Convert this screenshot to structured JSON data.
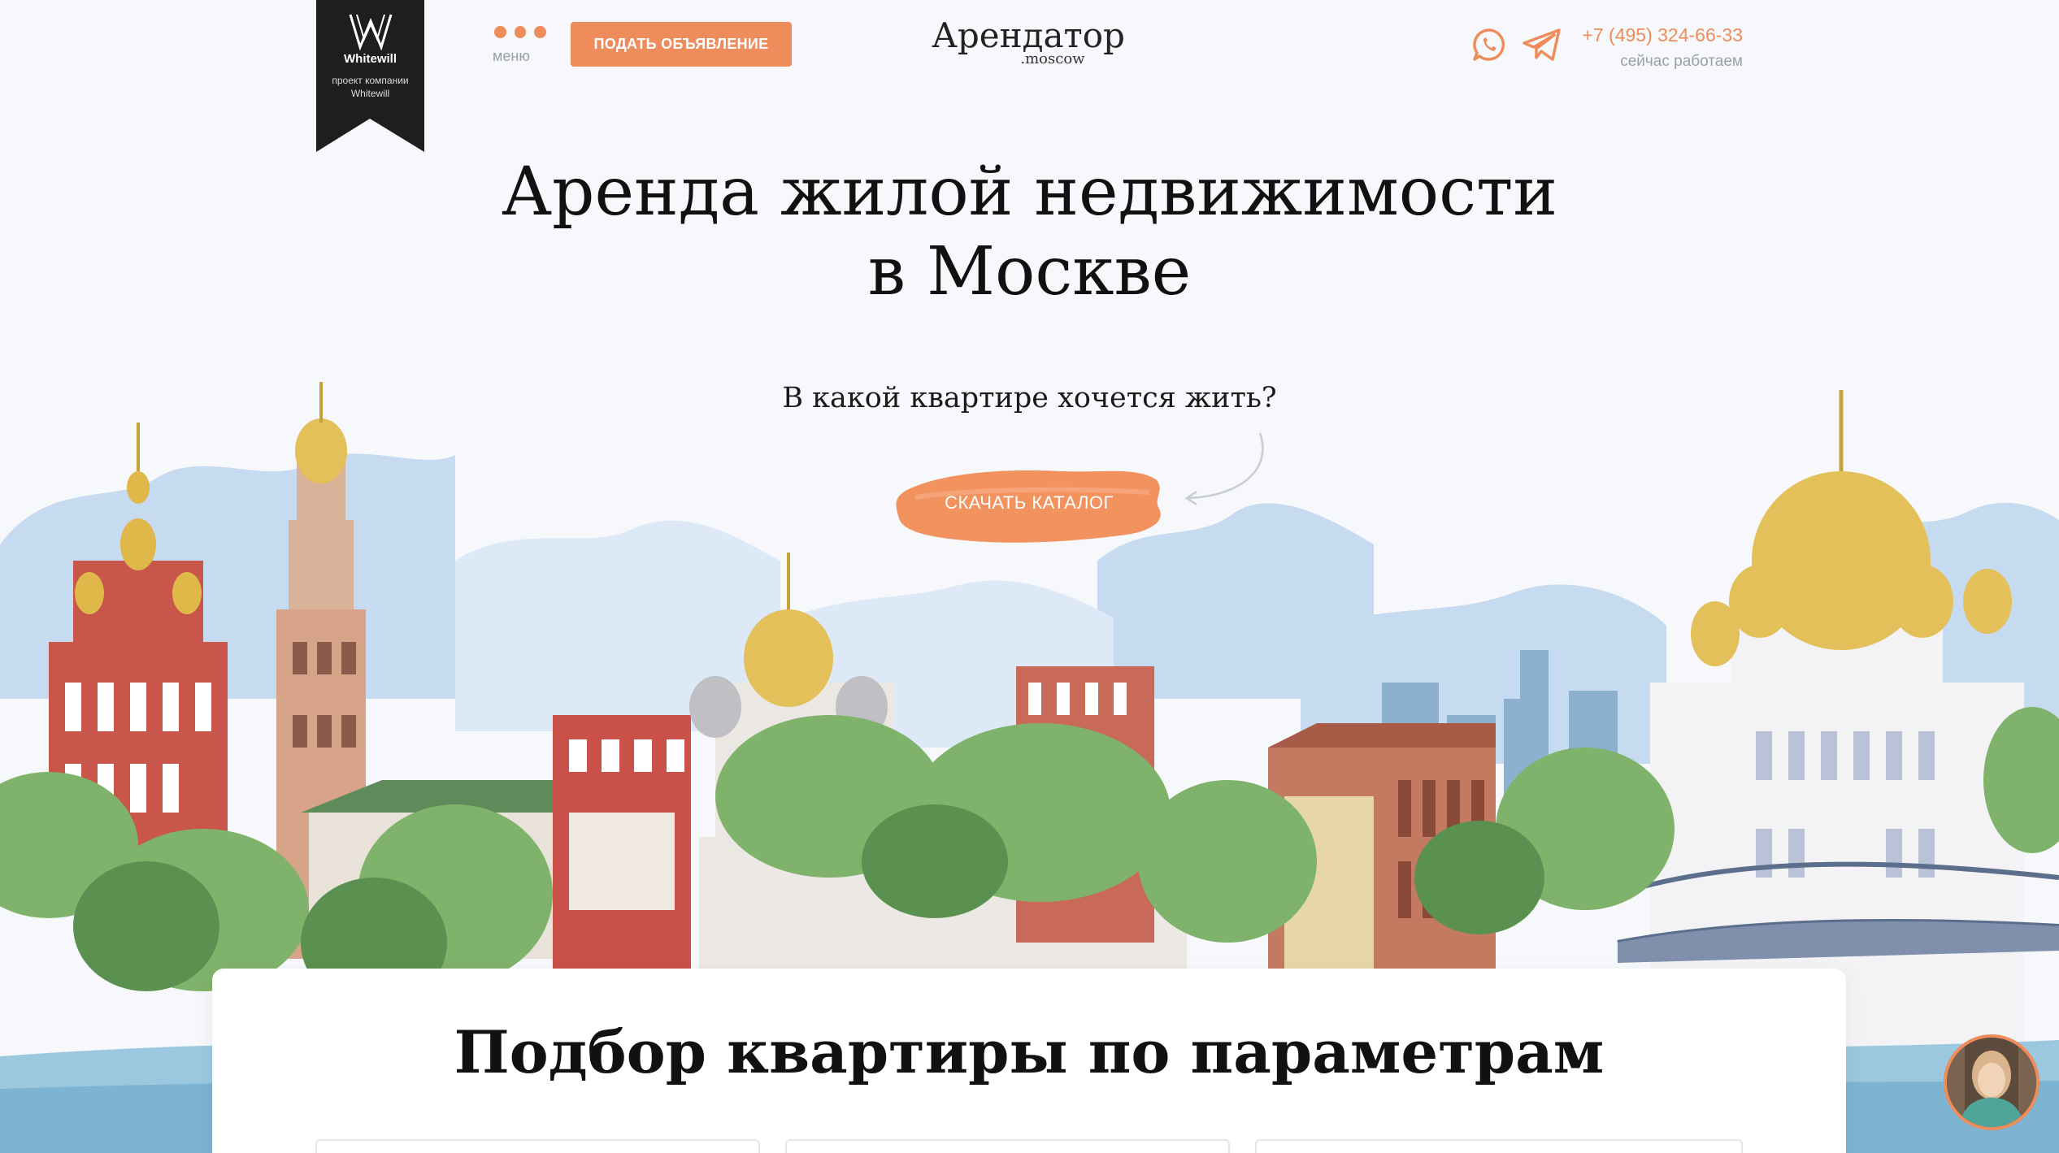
{
  "badge": {
    "brand": "Whitewill",
    "subtitle_line1": "проект компании",
    "subtitle_line2": "Whitewill"
  },
  "header": {
    "menu_label": "меню",
    "post_ad_label": "ПОДАТЬ ОБЪЯВЛЕНИЕ",
    "logo_name": "Арендатор",
    "logo_domain": ".moscow",
    "phone": "+7 (495) 324-66-33",
    "hours": "сейчас работаем"
  },
  "hero": {
    "title_line1": "Аренда жилой недвижимости",
    "title_line2": "в Москве",
    "question": "В какой квартире хочется жить?",
    "catalog_label": "СКАЧАТЬ КАТАЛОГ"
  },
  "filter": {
    "title": "Подбор квартиры по параметрам"
  },
  "colors": {
    "accent": "#ef8c5c",
    "badge": "#1e1e1e",
    "muted": "#9aa0a6"
  },
  "icons": [
    "whitewill-logo",
    "menu-dots-icon",
    "whatsapp-icon",
    "telegram-icon",
    "curved-arrow-icon",
    "chat-avatar"
  ]
}
